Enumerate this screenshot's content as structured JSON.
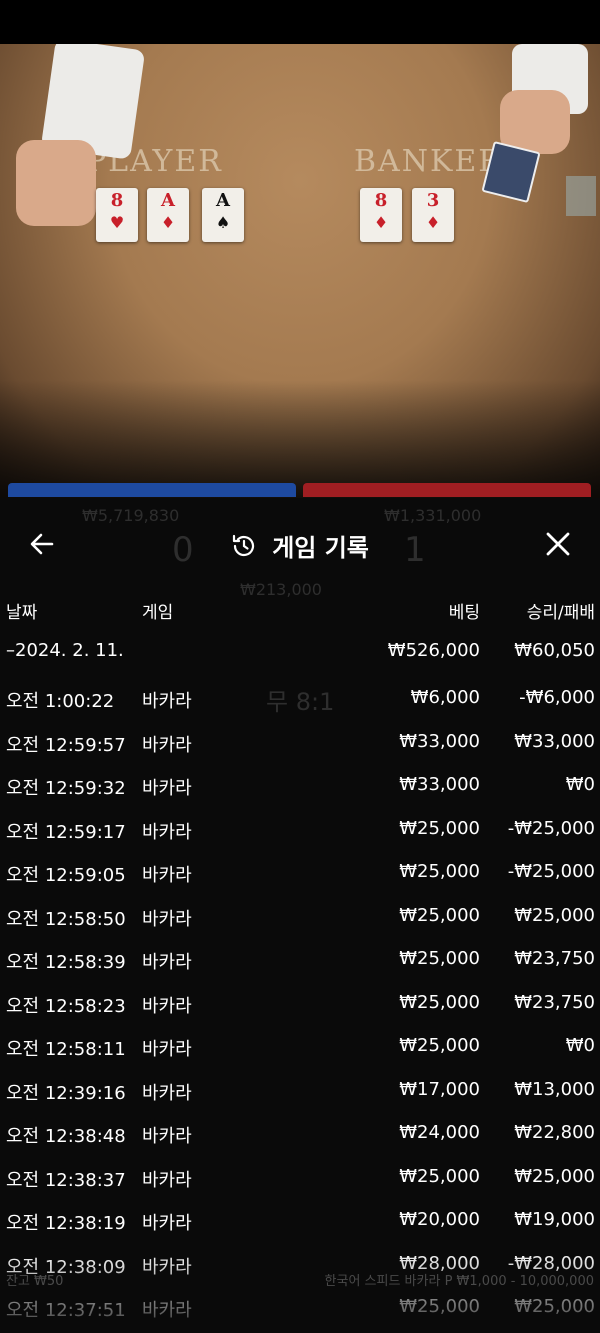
{
  "table": {
    "player_label": "PLAYER",
    "banker_label": "BANKER"
  },
  "cards": {
    "player": [
      {
        "rank": "8",
        "suit": "♥",
        "color": "red"
      },
      {
        "rank": "A",
        "suit": "♦",
        "color": "red"
      },
      {
        "rank": "A",
        "suit": "♠",
        "color": "black"
      }
    ],
    "banker": [
      {
        "rank": "8",
        "suit": "♦",
        "color": "red"
      },
      {
        "rank": "3",
        "suit": "♦",
        "color": "red"
      }
    ]
  },
  "background_ghosts": {
    "player_balance": "₩5,719,830",
    "banker_balance": "₩1,331,000",
    "player_score": "0",
    "banker_score": "1",
    "total_bet": "₩213,000",
    "tie_odds": "무 8:1",
    "footer_left": "잔고 ₩50",
    "footer_right": "한국어 스피드 바카라 P ₩1,000 - 10,000,000"
  },
  "header": {
    "title": "게임 기록",
    "back_icon": "arrow-left-icon",
    "history_icon": "history-icon",
    "close_icon": "close-icon"
  },
  "columns": {
    "date": "날짜",
    "game": "게임",
    "bet": "베팅",
    "result": "승리/패배"
  },
  "day_summary": {
    "date": "2024. 2. 11.",
    "bet": "₩526,000",
    "result": "₩60,050"
  },
  "rows": [
    {
      "time": "오전 1:00:22",
      "game": "바카라",
      "bet": "₩6,000",
      "result": "-₩6,000"
    },
    {
      "time": "오전 12:59:57",
      "game": "바카라",
      "bet": "₩33,000",
      "result": "₩33,000"
    },
    {
      "time": "오전 12:59:32",
      "game": "바카라",
      "bet": "₩33,000",
      "result": "₩0"
    },
    {
      "time": "오전 12:59:17",
      "game": "바카라",
      "bet": "₩25,000",
      "result": "-₩25,000"
    },
    {
      "time": "오전 12:59:05",
      "game": "바카라",
      "bet": "₩25,000",
      "result": "-₩25,000"
    },
    {
      "time": "오전 12:58:50",
      "game": "바카라",
      "bet": "₩25,000",
      "result": "₩25,000"
    },
    {
      "time": "오전 12:58:39",
      "game": "바카라",
      "bet": "₩25,000",
      "result": "₩23,750"
    },
    {
      "time": "오전 12:58:23",
      "game": "바카라",
      "bet": "₩25,000",
      "result": "₩23,750"
    },
    {
      "time": "오전 12:58:11",
      "game": "바카라",
      "bet": "₩25,000",
      "result": "₩0"
    },
    {
      "time": "오전 12:39:16",
      "game": "바카라",
      "bet": "₩17,000",
      "result": "₩13,000"
    },
    {
      "time": "오전 12:38:48",
      "game": "바카라",
      "bet": "₩24,000",
      "result": "₩22,800"
    },
    {
      "time": "오전 12:38:37",
      "game": "바카라",
      "bet": "₩25,000",
      "result": "₩25,000"
    },
    {
      "time": "오전 12:38:19",
      "game": "바카라",
      "bet": "₩20,000",
      "result": "₩19,000"
    },
    {
      "time": "오전 12:38:09",
      "game": "바카라",
      "bet": "₩28,000",
      "result": "-₩28,000"
    },
    {
      "time": "오전 12:37:51",
      "game": "바카라",
      "bet": "₩25,000",
      "result": "₩25,000"
    }
  ],
  "colors": {
    "panel": "#0a0a0a",
    "player_strip": "#1e4aa0",
    "banker_strip": "#a01e22",
    "felt": "#a47a50"
  }
}
